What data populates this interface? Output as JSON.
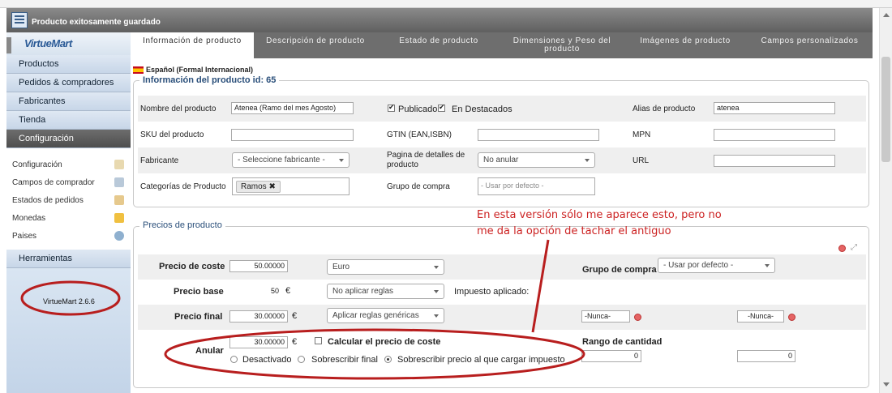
{
  "window": {
    "title": "Producto exitosamente guardado"
  },
  "sidebar": {
    "logo": "VirtueMart",
    "menu": [
      "Productos",
      "Pedidos & compradores",
      "Fabricantes",
      "Tienda",
      "Configuración"
    ],
    "submenu": [
      "Configuración",
      "Campos de comprador",
      "Estados de pedidos",
      "Monedas",
      "Paises"
    ],
    "tools": "Herramientas",
    "version": "VirtueMart 2.6.6"
  },
  "tabs": [
    "Información de producto",
    "Descripción de producto",
    "Estado de producto",
    "Dimensiones y Peso del producto",
    "Imágenes de producto",
    "Campos personalizados"
  ],
  "language": "Español (Formal Internacional)",
  "info_section": {
    "legend": "Información del producto id: 65",
    "nombre_label": "Nombre del producto",
    "nombre_value": "Atenea (Ramo del mes Agosto)",
    "publicado_label": "Publicado",
    "destacados_label": "En Destacados",
    "alias_label": "Alias de producto",
    "alias_value": "atenea",
    "sku_label": "SKU del producto",
    "gtin_label": "GTIN (EAN,ISBN)",
    "mpn_label": "MPN",
    "fabricante_label": "Fabricante",
    "fabricante_select": "- Seleccione fabricante -",
    "pagina_label": "Pagina de detalles de producto",
    "pagina_select": "No anular",
    "url_label": "URL",
    "categorias_label": "Categorías de Producto",
    "categoria_tag": "Ramos",
    "grupo_label": "Grupo de compra",
    "grupo_placeholder": "- Usar por defecto -"
  },
  "prices_section": {
    "legend": "Precios de producto",
    "coste_label": "Precio de coste",
    "coste_value": "50.00000",
    "moneda_select": "Euro",
    "base_label": "Precio base",
    "base_value": "50",
    "base_currency": "€",
    "reglas_select": "No aplicar reglas",
    "impuesto_label": "Impuesto aplicado:",
    "final_label": "Precio final",
    "final_value": "30.00000",
    "final_currency": "€",
    "reglas2_select": "Aplicar reglas genéricas",
    "anular_label": "Anular",
    "anular_value": "30.00000",
    "anular_currency": "€",
    "calcular_label": "Calcular el precio de coste",
    "radio_desactivado": "Desactivado",
    "radio_final": "Sobrescribir final",
    "radio_impuesto": "Sobrescribir precio al que cargar impuesto",
    "grupo_label": "Grupo de compra",
    "grupo_select": "- Usar por defecto -",
    "nunca1": "-Nunca-",
    "nunca2": "-Nunca-",
    "rango_label": "Rango de cantidad",
    "rango_from": "0",
    "rango_to": "0"
  },
  "annotation": {
    "line1": "En esta versión sólo me aparece esto, pero no",
    "line2": "me da la opción de tachar el antiguo",
    "color": "#cc2222"
  }
}
